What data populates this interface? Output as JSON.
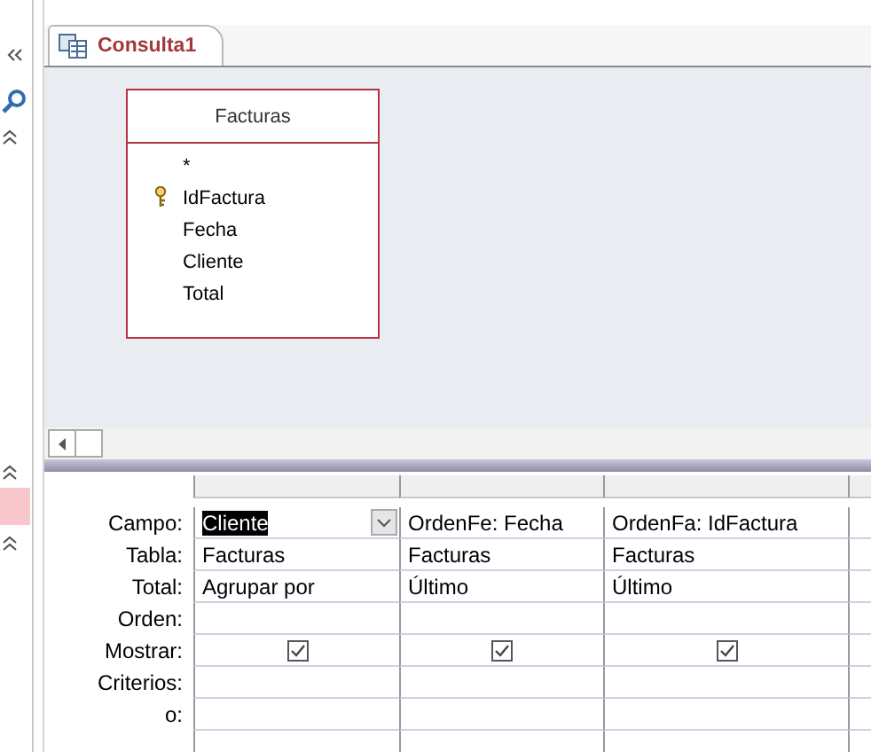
{
  "tab": {
    "title": "Consulta1",
    "selected": true
  },
  "table_box": {
    "title": "Facturas",
    "fields": [
      {
        "name": "*",
        "primary_key": false
      },
      {
        "name": "IdFactura",
        "primary_key": true
      },
      {
        "name": "Fecha",
        "primary_key": false
      },
      {
        "name": "Cliente",
        "primary_key": false
      },
      {
        "name": "Total",
        "primary_key": false
      }
    ]
  },
  "grid": {
    "row_labels": [
      "Campo:",
      "Tabla:",
      "Total:",
      "Orden:",
      "Mostrar:",
      "Criterios:",
      "o:"
    ],
    "columns": [
      {
        "field": "Cliente",
        "selected": true,
        "table": "Facturas",
        "total": "Agrupar por",
        "show": true
      },
      {
        "field": "OrdenFe: Fecha",
        "selected": false,
        "table": "Facturas",
        "total": "Último",
        "show": true
      },
      {
        "field": "OrdenFa: IdFactura",
        "selected": false,
        "table": "Facturas",
        "total": "Último",
        "show": true
      }
    ]
  }
}
